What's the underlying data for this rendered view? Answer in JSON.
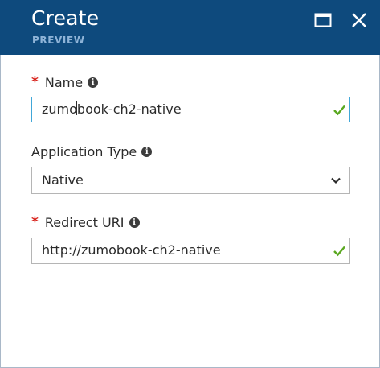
{
  "header": {
    "title": "Create",
    "subtitle": "PREVIEW",
    "maximize_icon": "maximize-icon",
    "close_icon": "close-icon",
    "background": "#0e4a7d"
  },
  "form": {
    "name": {
      "label": "Name",
      "required_marker": "*",
      "value_before_caret": "zumo",
      "value_after_caret": "book-ch2-native",
      "valid": true
    },
    "application_type": {
      "label": "Application Type",
      "selected": "Native"
    },
    "redirect_uri": {
      "label": "Redirect URI",
      "required_marker": "*",
      "value": "http://zumobook-ch2-native",
      "valid": true
    }
  },
  "colors": {
    "required": "#d8231c",
    "valid_check": "#5aa820",
    "focus_border": "#41a7d8"
  }
}
